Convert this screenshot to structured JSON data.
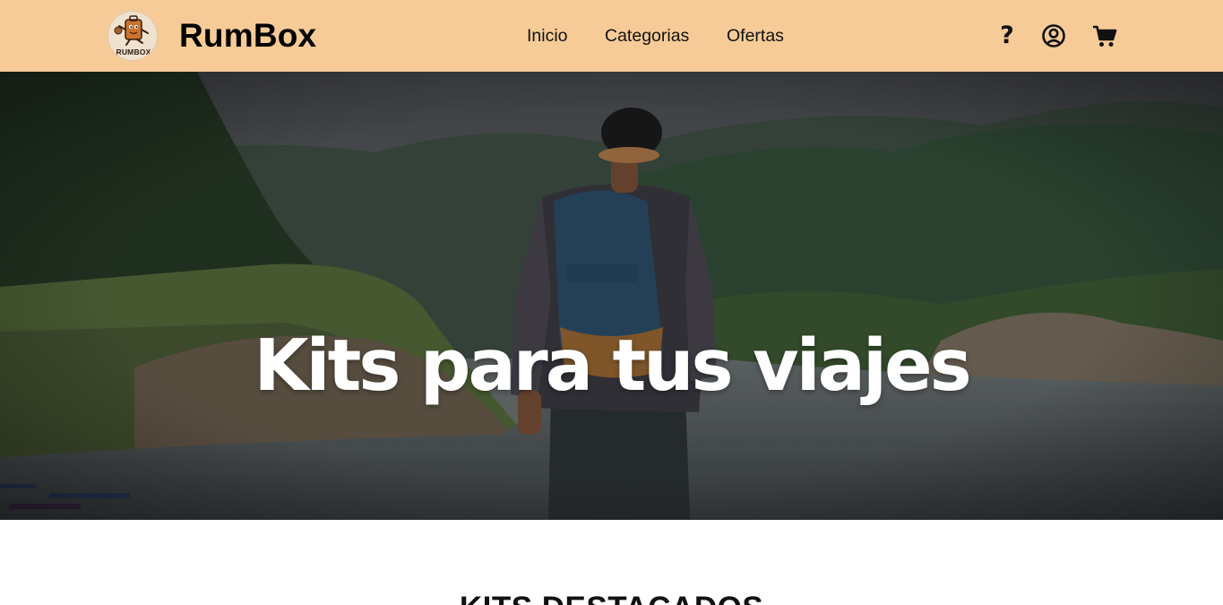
{
  "header": {
    "brand": "RumBox",
    "logo_text": "RUMBOX",
    "nav": [
      {
        "label": "Inicio"
      },
      {
        "label": "Categorias"
      },
      {
        "label": "Ofertas"
      }
    ],
    "icons": {
      "help": "?",
      "account": "user-circle-icon",
      "cart": "shopping-cart-icon"
    },
    "background_color": "#f6cb97"
  },
  "hero": {
    "title": "Kits para tus viajes",
    "image": "hiker-with-backpack-overlooking-lake-and-forested-hills"
  },
  "featured": {
    "title": "KITS DESTACADOS"
  }
}
